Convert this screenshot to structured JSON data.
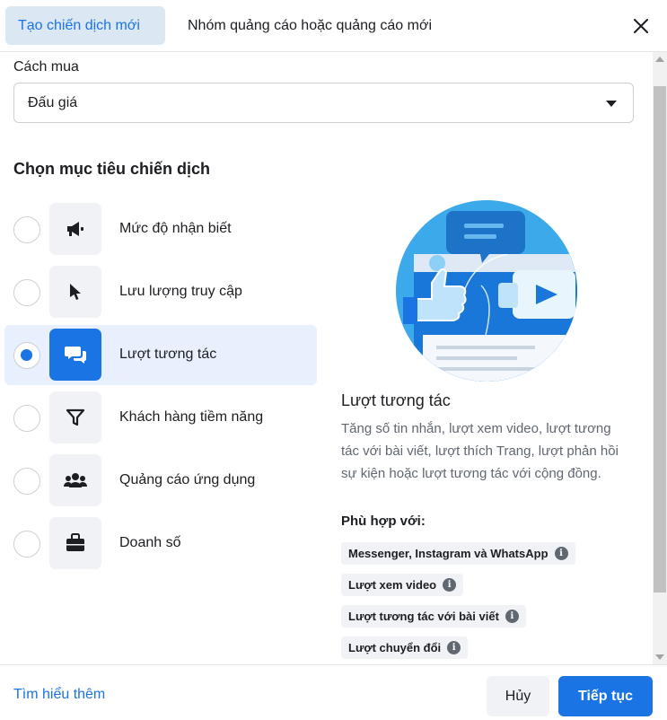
{
  "header": {
    "tabs": [
      {
        "label": "Tạo chiến dịch mới",
        "active": true
      },
      {
        "label": "Nhóm quảng cáo hoặc quảng cáo mới",
        "active": false
      }
    ],
    "close_icon": "close-icon"
  },
  "buying": {
    "label": "Cách mua",
    "selected": "Đấu giá"
  },
  "objectives": {
    "title": "Chọn mục tiêu chiến dịch",
    "items": [
      {
        "label": "Mức độ nhận biết",
        "icon": "megaphone-icon",
        "selected": false
      },
      {
        "label": "Lưu lượng truy cập",
        "icon": "cursor-icon",
        "selected": false
      },
      {
        "label": "Lượt tương tác",
        "icon": "chat-bubbles-icon",
        "selected": true
      },
      {
        "label": "Khách hàng tiềm năng",
        "icon": "funnel-icon",
        "selected": false
      },
      {
        "label": "Quảng cáo ứng dụng",
        "icon": "people-icon",
        "selected": false
      },
      {
        "label": "Doanh số",
        "icon": "briefcase-icon",
        "selected": false
      }
    ]
  },
  "detail": {
    "title": "Lượt tương tác",
    "description": "Tăng số tin nhắn, lượt xem video, lượt tương tác với bài viết, lượt thích Trang, lượt phản hồi sự kiện hoặc lượt tương tác với cộng đồng.",
    "fit_title": "Phù hợp với:",
    "fit_items": [
      "Messenger, Instagram và WhatsApp",
      "Lượt xem video",
      "Lượt tương tác với bài viết",
      "Lượt chuyển đổi"
    ]
  },
  "footer": {
    "learn_more": "Tìm hiểu thêm",
    "cancel": "Hủy",
    "next": "Tiếp tục"
  },
  "colors": {
    "accent": "#1b74e4",
    "selected_bg": "#e7f0fc",
    "active_tab_bg": "#dbe7f2",
    "muted_text": "#606770"
  }
}
